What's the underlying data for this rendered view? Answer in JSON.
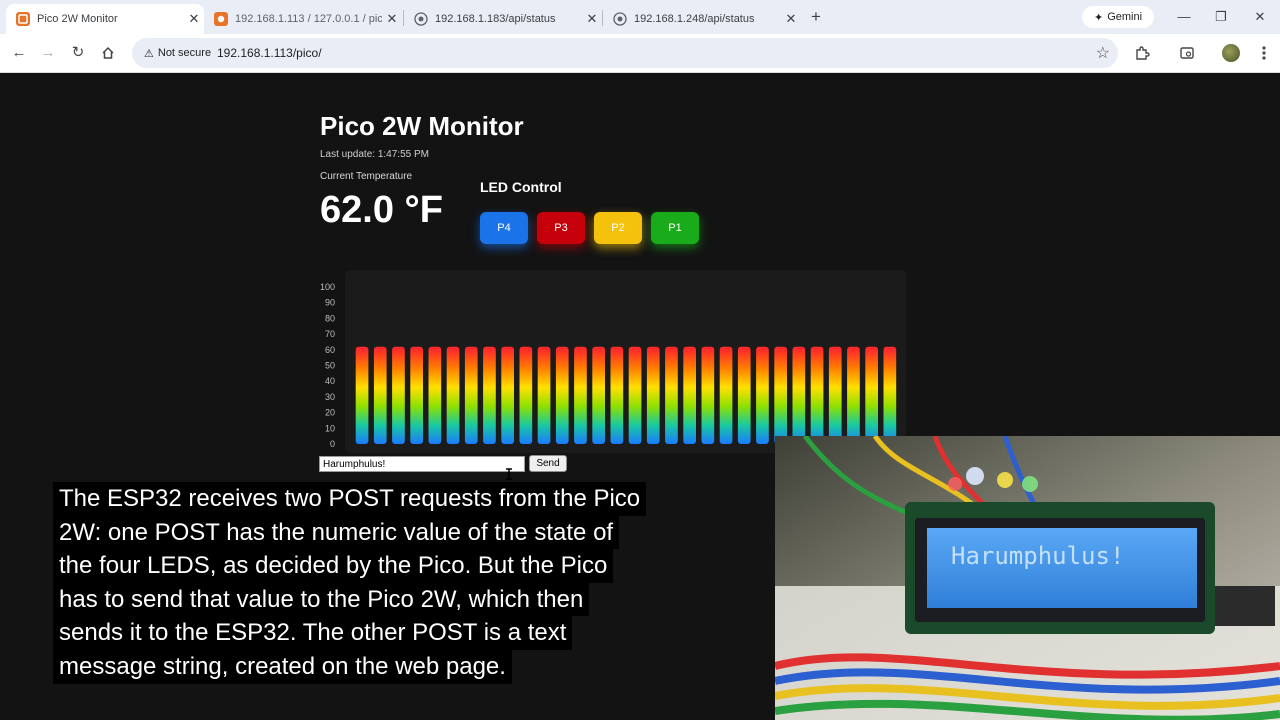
{
  "browser": {
    "tabs": [
      {
        "title": "Pico 2W Monitor",
        "active": true
      },
      {
        "title": "192.168.1.113 / 127.0.0.1 / pico",
        "active": false
      },
      {
        "title": "192.168.1.183/api/status",
        "active": false
      },
      {
        "title": "192.168.1.248/api/status",
        "active": false
      }
    ],
    "gemini_label": "Gemini",
    "security_label": "Not secure",
    "url": "192.168.1.113/pico/"
  },
  "page": {
    "title": "Pico 2W Monitor",
    "last_update": "Last update: 1:47:55 PM",
    "temperature_label": "Current Temperature",
    "temperature_value": "62.0 °F",
    "led_title": "LED Control",
    "leds": [
      {
        "label": "P4",
        "color": "#1a73e8"
      },
      {
        "label": "P3",
        "color": "#c5000a"
      },
      {
        "label": "P2",
        "color": "#f4c20d"
      },
      {
        "label": "P1",
        "color": "#1aab1a"
      }
    ],
    "message_value": "Harumphulus!",
    "send_label": "Send"
  },
  "chart_data": {
    "type": "bar",
    "y_ticks": [
      "100",
      "90",
      "80",
      "70",
      "60",
      "50",
      "40",
      "30",
      "20",
      "10",
      "0"
    ],
    "ylim": [
      0,
      100
    ],
    "values": [
      62,
      62,
      62,
      62,
      62,
      62,
      62,
      62,
      62,
      62,
      62,
      62,
      62,
      62,
      62,
      62,
      62,
      62,
      62,
      62,
      62,
      62,
      62,
      62,
      62,
      62,
      62,
      62,
      62,
      62
    ],
    "grid": false,
    "gradient_colors": [
      "#1a7bff",
      "#19c9a0",
      "#8ee000",
      "#ffe000",
      "#ff8000",
      "#ff2a2a"
    ]
  },
  "caption": {
    "lines": [
      "The ESP32 receives two POST requests from the Pico",
      "2W: one POST has the numeric value of the state of",
      "the four LEDS, as decided by the Pico. But the Pico",
      "has to send that value to the Pico 2W, which then",
      "sends it to the ESP32. The other POST is a text",
      "message string, created on the web page."
    ]
  },
  "camera_inset": {
    "lcd_text": "Harumphulus!",
    "lcd_color": "#4f9ff0"
  }
}
